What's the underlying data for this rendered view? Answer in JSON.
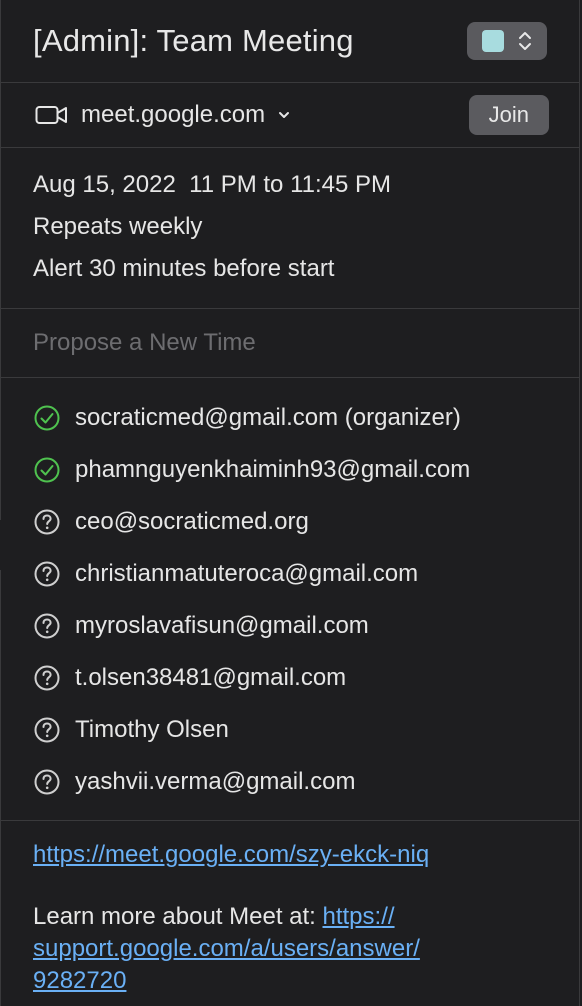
{
  "event": {
    "title": "[Admin]: Team Meeting",
    "calendar_color": "#a8dcdf"
  },
  "location": {
    "service": "meet.google.com",
    "join_label": "Join",
    "icon": "video-camera-icon"
  },
  "details": {
    "datetime": "Aug 15, 2022  11 PM to 11:45 PM",
    "repeat": "Repeats weekly",
    "alert": "Alert 30 minutes before start"
  },
  "propose_placeholder": "Propose a New Time",
  "attendees": [
    {
      "name": "socraticmed@gmail.com (organizer)",
      "status": "accepted"
    },
    {
      "name": "phamnguyenkhaiminh93@gmail.com",
      "status": "accepted"
    },
    {
      "name": "ceo@socraticmed.org",
      "status": "unknown"
    },
    {
      "name": "christianmatuteroca@gmail.com",
      "status": "unknown"
    },
    {
      "name": "myroslavafisun@gmail.com",
      "status": "unknown"
    },
    {
      "name": "t.olsen38481@gmail.com",
      "status": "unknown"
    },
    {
      "name": "Timothy Olsen",
      "status": "unknown"
    },
    {
      "name": "yashvii.verma@gmail.com",
      "status": "unknown"
    }
  ],
  "notes": {
    "meet_link": "https://meet.google.com/szy-ekck-niq",
    "learn_more_prefix": "Learn more about Meet at: ",
    "support_link_part1": "https://",
    "support_link_part2": "support.google.com/a/users/answer/",
    "support_link_part3": "9282720"
  },
  "colors": {
    "accepted": "#4fc24f",
    "unknown": "#cfcfcf",
    "link": "#6ab0f5"
  }
}
